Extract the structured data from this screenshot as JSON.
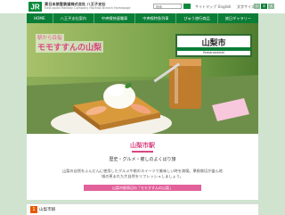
{
  "header": {
    "company_jp": "東日本旅客鉄道株式会社 八王子支社",
    "company_en": "East Japan Railway Company Hachioji Branch Homepage",
    "search_placeholder": "検索",
    "sitemap_label": "サイトマップ",
    "english_label": "English",
    "font_size_label": "文字サイズ",
    "font_sizes": [
      "小",
      "中",
      "大"
    ]
  },
  "nav": {
    "items": [
      "HOME",
      "八王子支社案内",
      "中央線快速電車",
      "中央線特急列車",
      "びゅう旅行商品",
      "旅日ギャラリー"
    ]
  },
  "banner": {
    "tagline": "駅から目指",
    "logo_text": "モモすすんの山梨",
    "sign_main": "山梨市",
    "sign_en": "Yamanashishi"
  },
  "content": {
    "station_title": "山梨市駅",
    "tagline": "歴史・グルメ・癒しのよくばり旅",
    "description": "山梨の自然をふんだんに使用したグルメや桃のスイーツで美味しい時を満喫。果樹栽培が盛ん地域の恵まれた大自然をリフレッシュしましょう。",
    "button_label": "山梨市駅周辺の「モモすすんの山梨」"
  },
  "section": {
    "number": "1",
    "label": "山梨市駅"
  },
  "colors": {
    "nav_bg": "#0a7d36",
    "accent_pink": "#d94583",
    "button_pink": "#e2619b",
    "page_bg": "#cfe3cf",
    "section_orange": "#e45a00"
  }
}
